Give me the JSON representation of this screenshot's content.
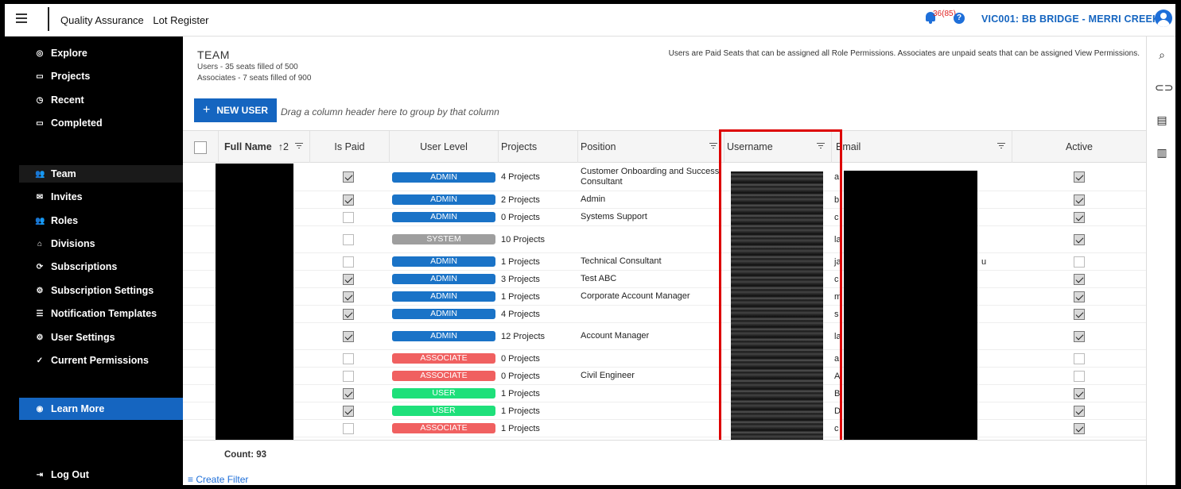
{
  "header": {
    "app_name": "Quality Assurance",
    "module": "Lot Register",
    "notification_count": "36(85)",
    "help": "?",
    "project": "VIC001: BB BRIDGE - MERRI CREEK"
  },
  "sidebar": {
    "items": [
      {
        "label": "Explore",
        "icon": "compass-icon",
        "glyph": "◎"
      },
      {
        "label": "Projects",
        "icon": "folder-icon",
        "glyph": "▭"
      },
      {
        "label": "Recent",
        "icon": "clock-icon",
        "glyph": "◷"
      },
      {
        "label": "Completed",
        "icon": "folder-check-icon",
        "glyph": "▭"
      },
      {
        "label": "Team",
        "icon": "people-icon",
        "glyph": "👥"
      },
      {
        "label": "Invites",
        "icon": "mail-icon",
        "glyph": "✉"
      },
      {
        "label": "Roles",
        "icon": "people-icon",
        "glyph": "👥"
      },
      {
        "label": "Divisions",
        "icon": "home-icon",
        "glyph": "⌂"
      },
      {
        "label": "Subscriptions",
        "icon": "sync-icon",
        "glyph": "⟳"
      },
      {
        "label": "Subscription Settings",
        "icon": "gear-icon",
        "glyph": "⚙"
      },
      {
        "label": "Notification Templates",
        "icon": "list-icon",
        "glyph": "☰"
      },
      {
        "label": "User Settings",
        "icon": "gear-icon",
        "glyph": "⚙"
      },
      {
        "label": "Current Permissions",
        "icon": "check-icon",
        "glyph": "✓"
      }
    ],
    "learn_more": "Learn More",
    "logout": "Log Out"
  },
  "main": {
    "title": "TEAM",
    "users_seats": "Users - 35 seats filled of 500",
    "associates_seats": "Associates - 7 seats filled of 900",
    "info": "Users are Paid Seats that can be assigned all Role Permissions. Associates are unpaid seats that can be assigned View Permissions.",
    "new_user": "NEW USER",
    "group_hint": "Drag a column header here to group by that column",
    "count": "Count: 93",
    "create_filter": "Create Filter"
  },
  "grid": {
    "columns": {
      "full_name": "Full Name",
      "sort_indicator": "↑2",
      "is_paid": "Is Paid",
      "user_level": "User Level",
      "projects": "Projects",
      "position": "Position",
      "username": "Username",
      "email": "Email",
      "active": "Active"
    },
    "rows": [
      {
        "paid": true,
        "level": "ADMIN",
        "projects": "4 Projects",
        "position": "Customer Onboarding and Success Consultant",
        "email_frag": "a",
        "active": true
      },
      {
        "paid": true,
        "level": "ADMIN",
        "projects": "2 Projects",
        "position": "Admin",
        "email_frag": "b",
        "active": true
      },
      {
        "paid": false,
        "level": "ADMIN",
        "projects": "0 Projects",
        "position": "Systems Support",
        "email_frag": "c",
        "active": true
      },
      {
        "paid": false,
        "level": "SYSTEM",
        "projects": "10 Projects",
        "position": "",
        "email_frag": "la",
        "active": true
      },
      {
        "paid": false,
        "level": "ADMIN",
        "projects": "1 Projects",
        "position": "Technical Consultant",
        "email_frag": "ja",
        "email_tail": "u",
        "active": false
      },
      {
        "paid": true,
        "level": "ADMIN",
        "projects": "3 Projects",
        "position": "Test ABC",
        "email_frag": "c",
        "active": true
      },
      {
        "paid": true,
        "level": "ADMIN",
        "projects": "1 Projects",
        "position": "Corporate Account Manager",
        "email_frag": "m",
        "active": true
      },
      {
        "paid": true,
        "level": "ADMIN",
        "projects": "4 Projects",
        "position": "",
        "email_frag": "s",
        "active": true
      },
      {
        "paid": true,
        "level": "ADMIN",
        "projects": "12 Projects",
        "position": "Account Manager",
        "email_frag": "la",
        "active": true
      },
      {
        "paid": false,
        "level": "ASSOCIATE",
        "projects": "0 Projects",
        "position": "",
        "email_frag": "a",
        "active": false
      },
      {
        "paid": false,
        "level": "ASSOCIATE",
        "projects": "0 Projects",
        "position": "Civil Engineer",
        "email_frag": "A",
        "active": false
      },
      {
        "paid": true,
        "level": "USER",
        "projects": "1 Projects",
        "position": "",
        "email_frag": "B",
        "active": true
      },
      {
        "paid": true,
        "level": "USER",
        "projects": "1 Projects",
        "position": "",
        "email_frag": "D",
        "active": true
      },
      {
        "paid": false,
        "level": "ASSOCIATE",
        "projects": "1 Projects",
        "position": "",
        "email_frag": "c",
        "active": true
      }
    ]
  },
  "colors": {
    "primary": "#1565c0",
    "ADMIN": "#1a73c7",
    "SYSTEM": "#9e9e9e",
    "ASSOCIATE": "#f06060",
    "USER": "#1ee07a",
    "highlight": "#dd0000"
  },
  "rail_icons": [
    "search-icon",
    "link-icon",
    "print-icon",
    "columns-icon"
  ]
}
